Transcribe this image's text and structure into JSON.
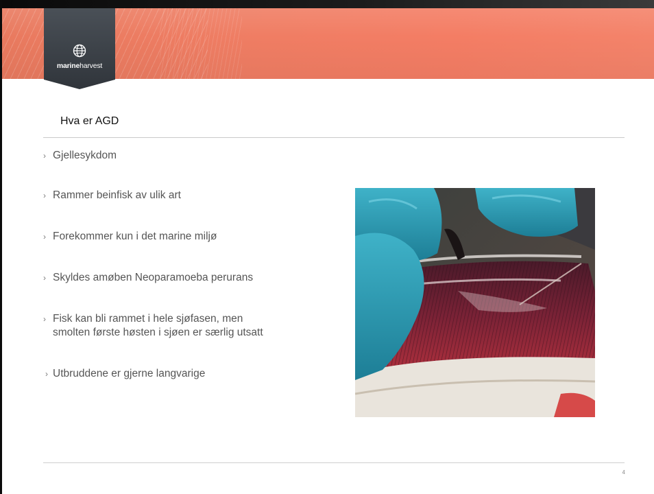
{
  "logo": {
    "brand_bold": "marine",
    "brand_light": "harvest",
    "icon": "globe-icon",
    "tab_color": "#3c4249"
  },
  "slide": {
    "title": "Hva er AGD",
    "bullets": [
      {
        "marker": "›",
        "lines": [
          "Gjellesykdom"
        ]
      },
      {
        "marker": "›",
        "lines": [
          "Rammer beinfisk av ulik art"
        ]
      },
      {
        "marker": "›",
        "lines": [
          "Forekommer kun i det marine miljø"
        ]
      },
      {
        "marker": "›",
        "lines": [
          "Skyldes amøben Neoparamoeba perurans"
        ]
      },
      {
        "marker": "›",
        "lines": [
          "Fisk kan bli rammet i hele sjøfasen, men",
          "smolten første høsten i sjøen er særlig utsatt"
        ]
      },
      {
        "marker": "›",
        "lines": [
          "Utbruddene er gjerne langvarige"
        ]
      }
    ],
    "page_number": "4"
  },
  "colors": {
    "banner": "#f07d63",
    "text": "#555555",
    "title": "#111111"
  }
}
